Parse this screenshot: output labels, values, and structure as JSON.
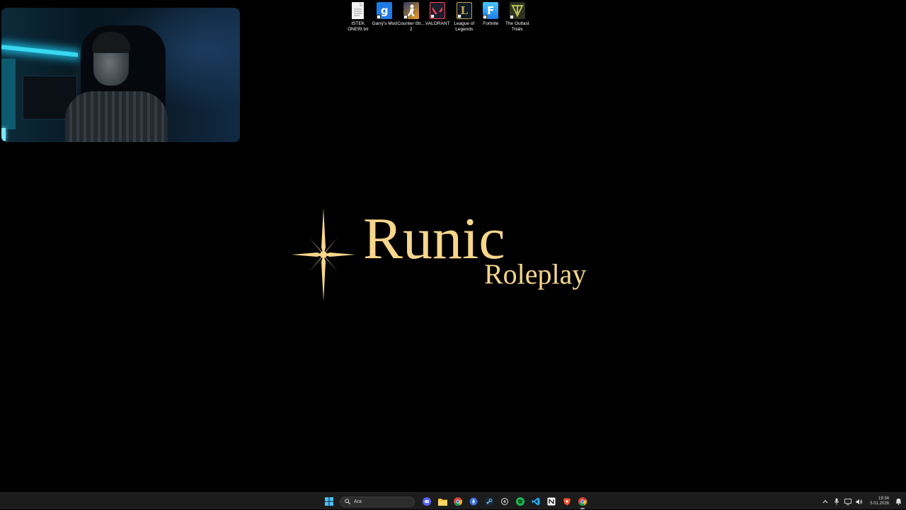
{
  "desktop": {
    "icons": [
      {
        "label": "ISTEK\nONERI.txt",
        "icon": "text-file-icon",
        "color": "#f2f2f2"
      },
      {
        "label": "Garry's Mod",
        "icon": "garrys-mod-icon",
        "color": "#1e7be6"
      },
      {
        "label": "Counter-Str...\n2",
        "icon": "counter-strike-icon",
        "color": "#f0a020"
      },
      {
        "label": "VALORANT",
        "icon": "valorant-icon",
        "color": "#ff4655"
      },
      {
        "label": "League of\nLegends",
        "icon": "league-of-legends-icon",
        "color": "#c8a24a"
      },
      {
        "label": "Fortnite",
        "icon": "fortnite-icon",
        "color": "#2aa3e8"
      },
      {
        "label": "The Outlast\nTrials",
        "icon": "outlast-trials-icon",
        "color": "#8a8f3a"
      }
    ]
  },
  "logo": {
    "title": "Runic",
    "subtitle": "Roleplay",
    "color": "#f7d68c"
  },
  "taskbar": {
    "search_placeholder": "Ara",
    "apps": [
      "windows-start-icon",
      "discord-icon",
      "file-explorer-icon",
      "chrome-icon",
      "app-blue-icon",
      "steam-icon",
      "app-settings-icon",
      "spotify-icon",
      "vscode-icon",
      "notion-icon",
      "brave-icon",
      "chrome-active-icon"
    ],
    "clock_time": "19:34",
    "clock_date": "5.01.2026"
  }
}
